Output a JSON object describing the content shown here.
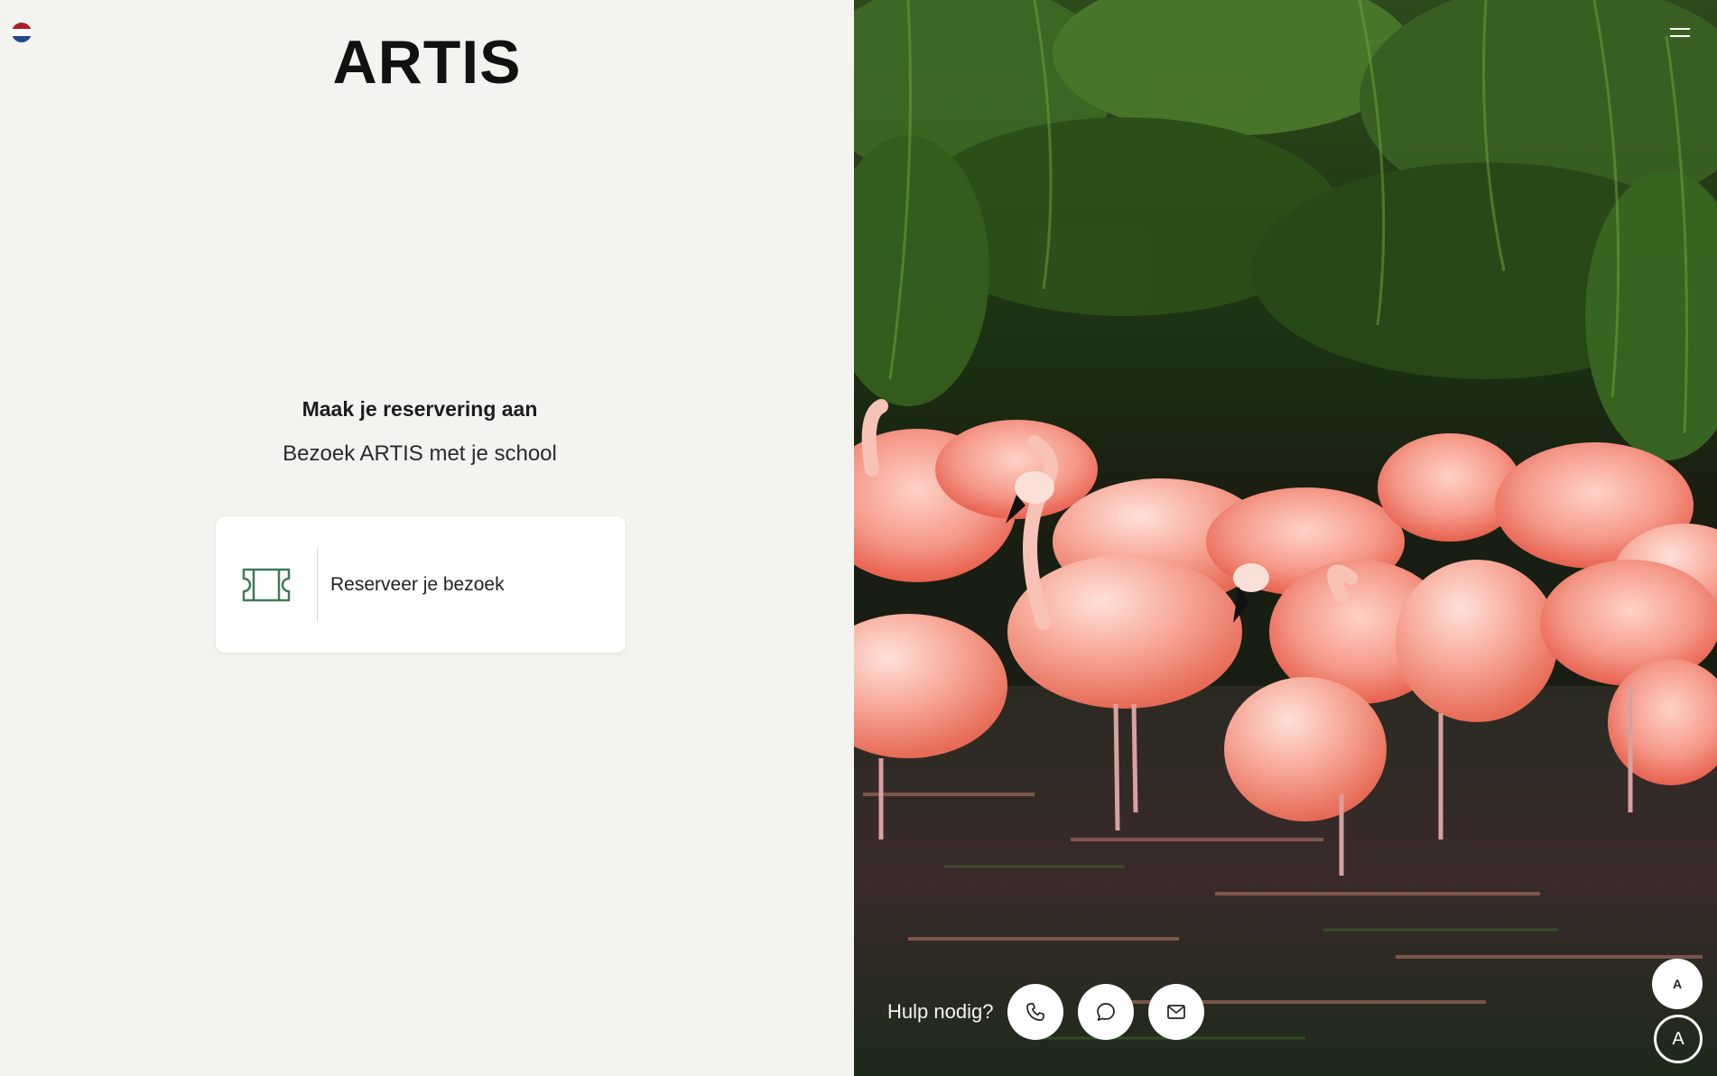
{
  "brand": {
    "logo_text": "ARTIS"
  },
  "language": {
    "flag_icon": "netherlands-flag-icon",
    "colors": [
      "#ae1c28",
      "#ffffff",
      "#21468b"
    ]
  },
  "main": {
    "heading": "Maak je reservering aan",
    "subheading": "Bezoek ARTIS met je school",
    "card": {
      "label": "Reserveer je bezoek",
      "icon": "ticket-icon",
      "icon_color": "#3f7a5a"
    }
  },
  "help": {
    "label": "Hulp nodig?",
    "buttons": [
      {
        "name": "phone",
        "icon": "phone-icon"
      },
      {
        "name": "chat",
        "icon": "chat-icon"
      },
      {
        "name": "email",
        "icon": "mail-icon"
      }
    ]
  },
  "accessibility": {
    "primary_label": "A",
    "secondary_label": "A"
  },
  "header": {
    "menu_icon": "hamburger-menu-icon"
  }
}
